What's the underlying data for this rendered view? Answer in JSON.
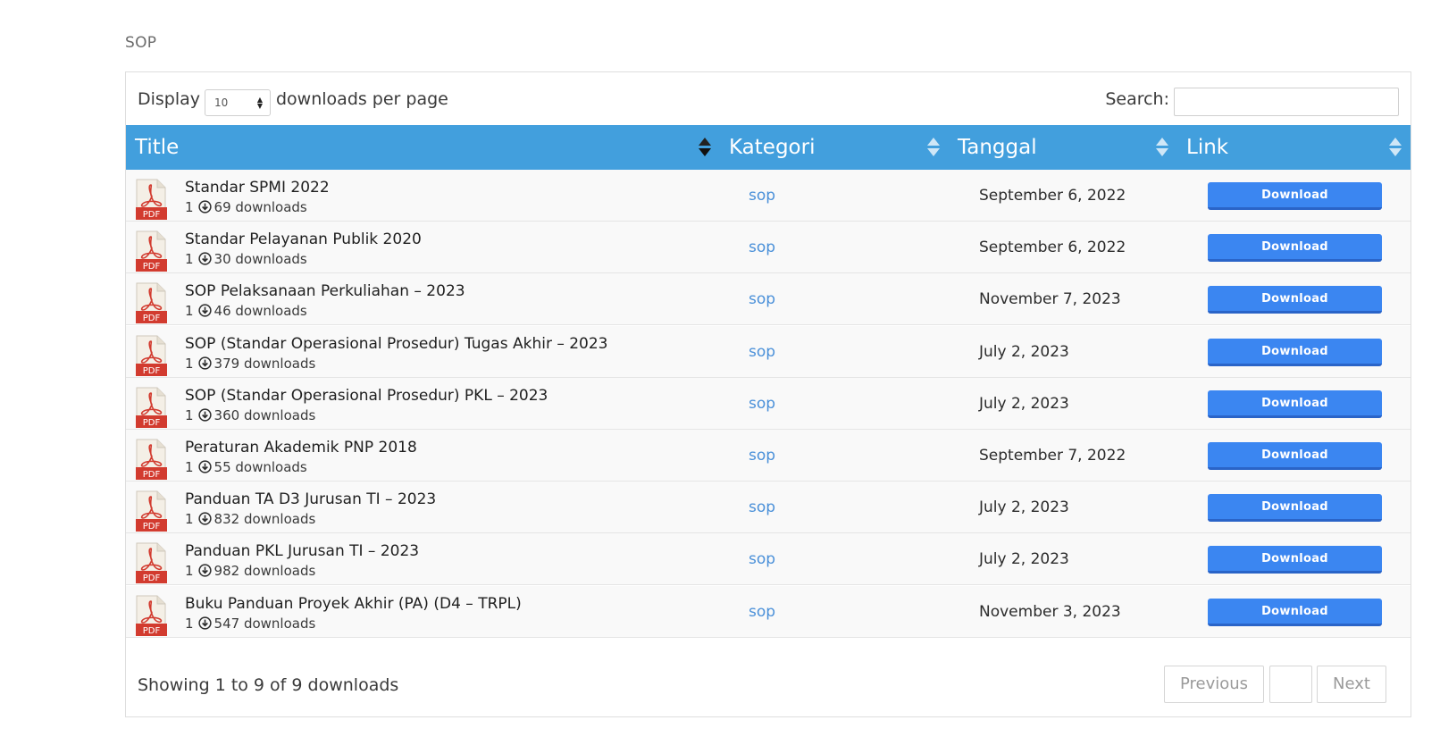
{
  "page": {
    "section_title": "SOP"
  },
  "controls": {
    "display_label": "Display",
    "page_size_value": "10",
    "per_page_label": "downloads per page",
    "search_label": "Search:",
    "search_value": ""
  },
  "table": {
    "columns": [
      "Title",
      "Kategori",
      "Tanggal",
      "Link"
    ],
    "rows": [
      {
        "title": "Standar SPMI 2022",
        "version": "1",
        "downloads": "69 downloads",
        "category": "sop",
        "date": "September 6, 2022",
        "link_label": "Download",
        "file_type": "PDF"
      },
      {
        "title": "Standar Pelayanan Publik 2020",
        "version": "1",
        "downloads": "30 downloads",
        "category": "sop",
        "date": "September 6, 2022",
        "link_label": "Download",
        "file_type": "PDF"
      },
      {
        "title": "SOP Pelaksanaan Perkuliahan – 2023",
        "version": "1",
        "downloads": "46 downloads",
        "category": "sop",
        "date": "November 7, 2023",
        "link_label": "Download",
        "file_type": "PDF"
      },
      {
        "title": "SOP (Standar Operasional Prosedur) Tugas Akhir – 2023",
        "version": "1",
        "downloads": "379 downloads",
        "category": "sop",
        "date": "July 2, 2023",
        "link_label": "Download",
        "file_type": "PDF"
      },
      {
        "title": "SOP (Standar Operasional Prosedur) PKL – 2023",
        "version": "1",
        "downloads": "360 downloads",
        "category": "sop",
        "date": "July 2, 2023",
        "link_label": "Download",
        "file_type": "PDF"
      },
      {
        "title": "Peraturan Akademik PNP 2018",
        "version": "1",
        "downloads": "55 downloads",
        "category": "sop",
        "date": "September 7, 2022",
        "link_label": "Download",
        "file_type": "PDF"
      },
      {
        "title": "Panduan TA D3 Jurusan TI – 2023",
        "version": "1",
        "downloads": "832 downloads",
        "category": "sop",
        "date": "July 2, 2023",
        "link_label": "Download",
        "file_type": "PDF"
      },
      {
        "title": "Panduan PKL Jurusan TI – 2023",
        "version": "1",
        "downloads": "982 downloads",
        "category": "sop",
        "date": "July 2, 2023",
        "link_label": "Download",
        "file_type": "PDF"
      },
      {
        "title": "Buku Panduan Proyek Akhir (PA) (D4 – TRPL)",
        "version": "1",
        "downloads": "547 downloads",
        "category": "sop",
        "date": "November 3, 2023",
        "link_label": "Download",
        "file_type": "PDF"
      }
    ]
  },
  "footer": {
    "info": "Showing 1 to 9 of 9 downloads",
    "previous_label": "Previous",
    "page_label": "",
    "next_label": "Next"
  },
  "colors": {
    "header_bg": "#429fdd",
    "button_bg": "#3b86f1",
    "link": "#4a90d9",
    "pdf_red": "#d23b2f"
  },
  "icons": {
    "file": "pdf-file-icon",
    "downloads": "download-circle-icon",
    "sort": "sort-arrows-icon"
  }
}
